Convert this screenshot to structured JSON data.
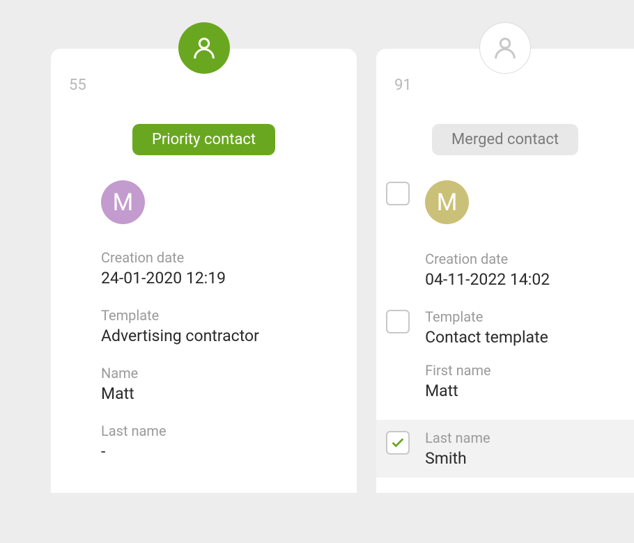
{
  "priority_card": {
    "number": "55",
    "badge_label": "Priority contact",
    "avatar_initial": "M",
    "fields": {
      "creation_date": {
        "label": "Creation date",
        "value": "24-01-2020 12:19"
      },
      "template": {
        "label": "Template",
        "value": "Advertising contractor"
      },
      "name": {
        "label": "Name",
        "value": "Matt"
      },
      "last_name": {
        "label": "Last name",
        "value": "-"
      }
    }
  },
  "merged_card": {
    "number": "91",
    "badge_label": "Merged contact",
    "avatar_initial": "M",
    "fields": {
      "creation_date": {
        "label": "Creation date",
        "value": "04-11-2022 14:02"
      },
      "template": {
        "label": "Template",
        "value": "Contact template"
      },
      "first_name": {
        "label": "First name",
        "value": "Matt"
      },
      "last_name": {
        "label": "Last name",
        "value": "Smith"
      }
    }
  }
}
